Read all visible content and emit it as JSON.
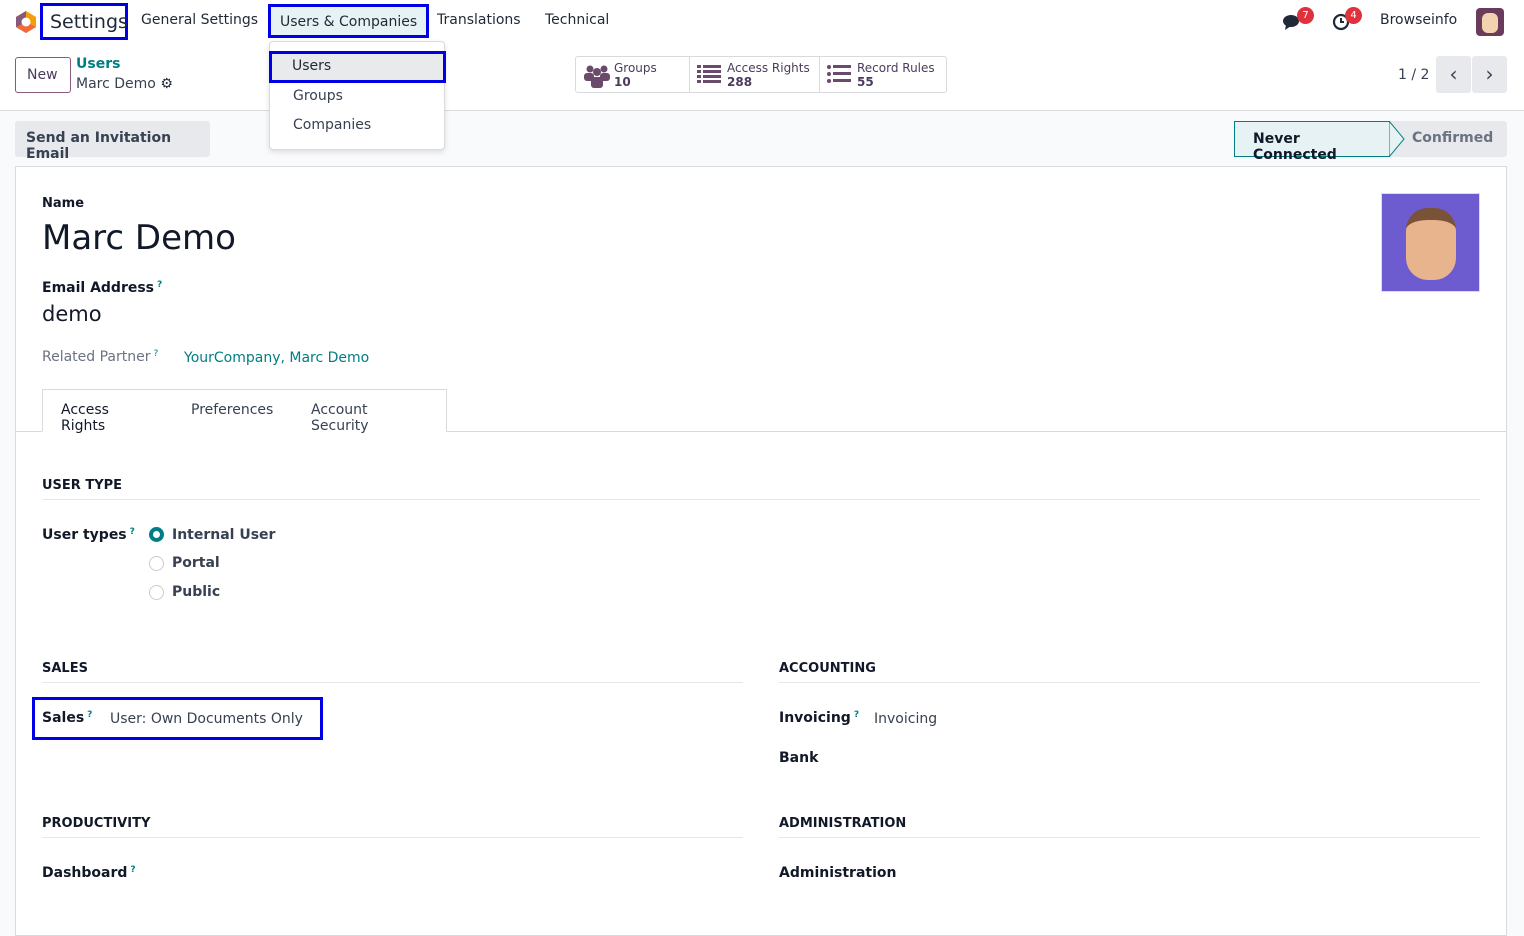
{
  "nav": {
    "app": "Settings",
    "items": [
      "General Settings",
      "Users & Companies",
      "Translations",
      "Technical"
    ],
    "messages_count": "7",
    "activities_count": "4",
    "user": "Browseinfo"
  },
  "dropdown": [
    "Users",
    "Groups",
    "Companies"
  ],
  "control": {
    "new": "New",
    "breadcrumb": "Users",
    "record": "Marc Demo",
    "stats": [
      {
        "label": "Groups",
        "value": "10"
      },
      {
        "label": "Access Rights",
        "value": "288"
      },
      {
        "label": "Record Rules",
        "value": "55"
      }
    ],
    "pager": "1 / 2"
  },
  "statusbar": {
    "invite": "Send an Invitation Email",
    "stages": [
      "Never Connected",
      "Confirmed"
    ]
  },
  "form": {
    "name_label": "Name",
    "name": "Marc Demo",
    "email_label": "Email Address",
    "email": "demo",
    "partner_label": "Related Partner",
    "partner": "YourCompany, Marc Demo",
    "help": "?",
    "tabs": [
      "Access Rights",
      "Preferences",
      "Account Security"
    ],
    "user_type_title": "USER TYPE",
    "user_types_label": "User types",
    "user_types": [
      "Internal User",
      "Portal",
      "Public"
    ],
    "sales_title": "SALES",
    "sales_label": "Sales",
    "sales_value": "User: Own Documents Only",
    "accounting_title": "ACCOUNTING",
    "invoicing_label": "Invoicing",
    "invoicing_value": "Invoicing",
    "bank_label": "Bank",
    "productivity_title": "PRODUCTIVITY",
    "dashboard_label": "Dashboard",
    "administration_title": "ADMINISTRATION",
    "administration_label": "Administration"
  }
}
